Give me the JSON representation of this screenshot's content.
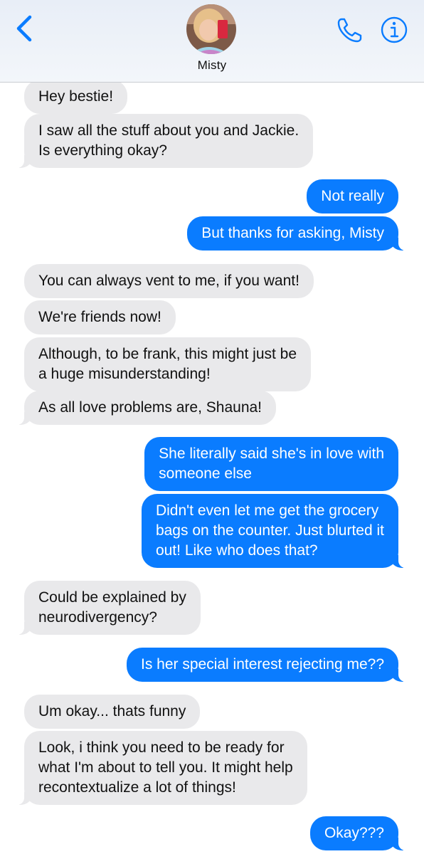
{
  "header": {
    "contact_name": "Misty",
    "colors": {
      "accent": "#0a7cff"
    },
    "icons": {
      "back": "chevron-left-icon",
      "phone": "phone-icon",
      "info": "info-icon"
    }
  },
  "messages": [
    {
      "dir": "in",
      "lines": [
        "Hey bestie!"
      ]
    },
    {
      "dir": "in",
      "lines": [
        "I saw all the stuff about you and Jackie.",
        "Is everything okay?"
      ]
    },
    {
      "dir": "out",
      "lines": [
        "Not really"
      ]
    },
    {
      "dir": "out",
      "lines": [
        "But thanks for asking, Misty"
      ]
    },
    {
      "dir": "in",
      "lines": [
        "You can always vent to me, if you want!"
      ]
    },
    {
      "dir": "in",
      "lines": [
        "We're friends now!"
      ]
    },
    {
      "dir": "in",
      "lines": [
        "Although, to be frank, this might just be",
        "a huge misunderstanding!"
      ]
    },
    {
      "dir": "in",
      "lines": [
        "As all love problems are, Shauna!"
      ]
    },
    {
      "dir": "out",
      "lines": [
        "She literally said she's in love with",
        "someone else"
      ]
    },
    {
      "dir": "out",
      "lines": [
        "Didn't even let me get the grocery",
        "bags on the counter. Just blurted it",
        "out! Like who does that?"
      ]
    },
    {
      "dir": "in",
      "lines": [
        "Could be explained by",
        "neurodivergency?"
      ]
    },
    {
      "dir": "out",
      "lines": [
        "Is her special interest rejecting me??"
      ]
    },
    {
      "dir": "in",
      "lines": [
        "Um okay... thats funny"
      ]
    },
    {
      "dir": "in",
      "lines": [
        "Look, i think you need to be ready for",
        "what I'm about to tell you. It might help",
        "recontextualize a lot of things!"
      ]
    },
    {
      "dir": "out",
      "lines": [
        "Okay???"
      ]
    }
  ]
}
